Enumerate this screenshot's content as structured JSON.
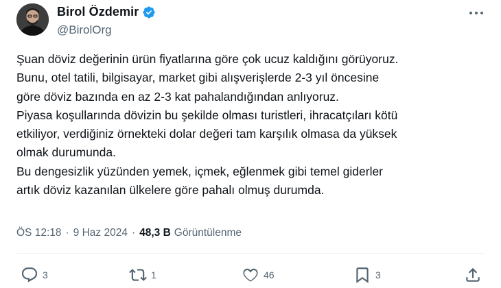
{
  "author": {
    "display_name": "Birol Özdemir",
    "handle": "@BirolOrg",
    "verified": true,
    "avatar_icon": "person-avatar"
  },
  "tweet": {
    "lines": [
      "Şuan döviz değerinin ürün fiyatlarına göre çok ucuz kaldığını görüyoruz.",
      "Bunu, otel tatili, bilgisayar, market gibi alışverişlerde 2-3 yıl öncesine",
      "göre döviz bazında en az 2-3 kat pahalandığından anlıyoruz.",
      "Piyasa koşullarında dövizin bu şekilde olması turistleri, ihracatçıları kötü",
      "etkiliyor, verdiğiniz örnekteki dolar değeri tam karşılık olmasa da yüksek",
      "olmak durumunda.",
      "Bu dengesizlik yüzünden yemek, içmek, eğlenmek gibi temel giderler",
      "artık döviz kazanılan ülkelere göre pahalı olmuş durumda."
    ]
  },
  "meta": {
    "time": "ÖS 12:18",
    "separator": "·",
    "date": "9 Haz 2024",
    "views_count": "48,3 B",
    "views_label": "Görüntülenme"
  },
  "actions": {
    "reply_count": "3",
    "retweet_count": "1",
    "like_count": "46",
    "bookmark_count": "3"
  },
  "colors": {
    "verified_badge": "#1d9bf0",
    "secondary_text": "#536471",
    "primary_text": "#0f1419"
  }
}
